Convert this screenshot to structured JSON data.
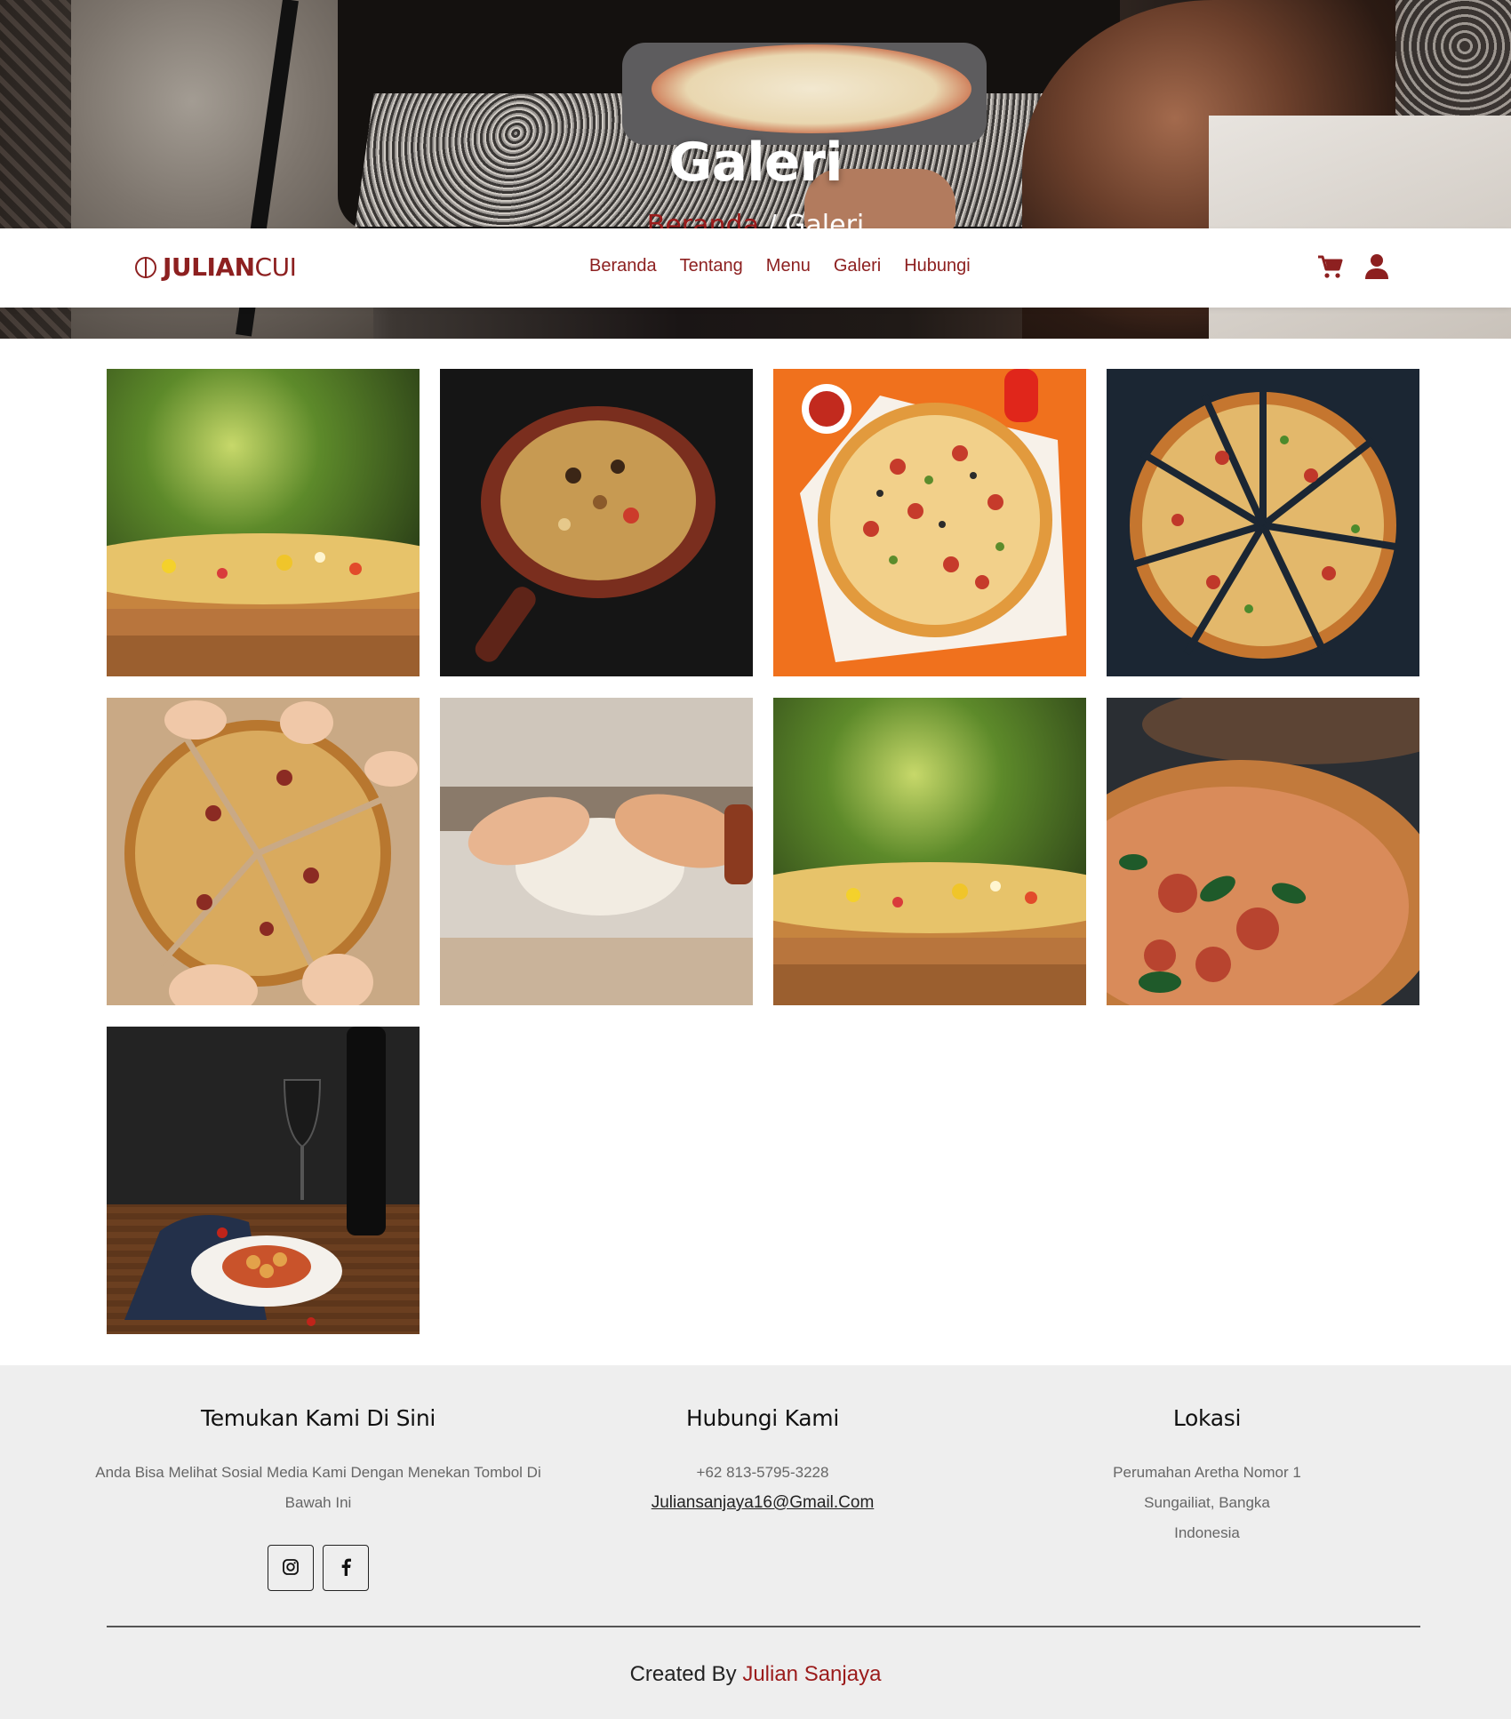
{
  "hero": {
    "title": "Galeri",
    "breadcrumb_home": "Beranda",
    "breadcrumb_sep": " / ",
    "breadcrumb_current": "Galeri"
  },
  "navbar": {
    "logo_first": "JULIAN",
    "logo_second": "CUI",
    "links": [
      "Beranda",
      "Tentang",
      "Menu",
      "Galeri",
      "Hubungi"
    ],
    "icons": [
      "cart-icon",
      "user-icon"
    ],
    "accent_color": "#8d2020"
  },
  "gallery": {
    "images": [
      "pizza-closeup-garden",
      "pizza-wooden-board",
      "pizza-orange-table",
      "pizza-sliced-dark",
      "pizza-hands-sharing",
      "dough-kneading",
      "pizza-closeup-garden-2",
      "pizza-basil-closeup",
      "pasta-wine-table"
    ]
  },
  "footer": {
    "col1": {
      "title": "Temukan Kami Di Sini",
      "desc": "Anda Bisa Melihat Sosial Media Kami Dengan Menekan Tombol Di Bawah Ini",
      "socials": [
        "instagram-icon",
        "facebook-icon"
      ]
    },
    "col2": {
      "title": "Hubungi Kami",
      "phone": "+62 813-5795-3228",
      "email": "Juliansanjaya16@Gmail.Com"
    },
    "col3": {
      "title": "Lokasi",
      "address_line1": "Perumahan Aretha Nomor 1",
      "address_line2": "Sungailiat, Bangka",
      "address_line3": "Indonesia"
    },
    "credit_prefix": "Created By ",
    "credit_author": "Julian Sanjaya"
  }
}
